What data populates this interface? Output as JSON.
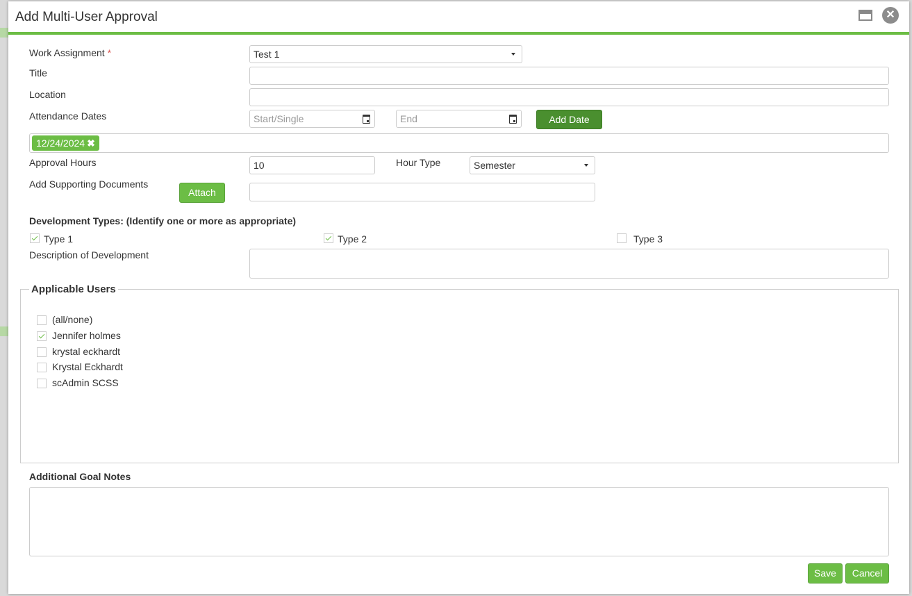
{
  "dialog": {
    "title": "Add Multi-User Approval"
  },
  "form": {
    "work_assignment_label": "Work Assignment",
    "required_mark": "*",
    "work_assignment_value": "Test 1",
    "title_label": "Title",
    "title_value": "",
    "location_label": "Location",
    "location_value": "",
    "attendance_label": "Attendance Dates",
    "start_placeholder": "Start/Single",
    "end_placeholder": "End",
    "add_date_label": "Add Date",
    "dates": [
      "12/24/2024"
    ],
    "approval_hours_label": "Approval Hours",
    "approval_hours_value": "10",
    "hour_type_label": "Hour Type",
    "hour_type_value": "Semester",
    "supporting_docs_label": "Add Supporting Documents",
    "attach_label": "Attach",
    "dev_types_label": "Development Types: (Identify one or more as appropriate)",
    "dev_types": [
      {
        "label": "Type 1",
        "checked": true
      },
      {
        "label": "Type 2",
        "checked": true
      },
      {
        "label": "Type 3",
        "checked": false
      }
    ],
    "description_label": "Description of Development",
    "applicable_users_label": "Applicable Users",
    "users": [
      {
        "label": "(all/none)",
        "checked": false
      },
      {
        "label": "Jennifer holmes",
        "checked": true
      },
      {
        "label": "krystal eckhardt",
        "checked": false
      },
      {
        "label": "Krystal Eckhardt",
        "checked": false
      },
      {
        "label": "scAdmin SCSS",
        "checked": false
      }
    ],
    "additional_notes_label": "Additional Goal Notes"
  },
  "actions": {
    "save_label": "Save",
    "cancel_label": "Cancel"
  },
  "colors": {
    "accent": "#6cbd45",
    "accent_dark": "#4a8f2f"
  }
}
